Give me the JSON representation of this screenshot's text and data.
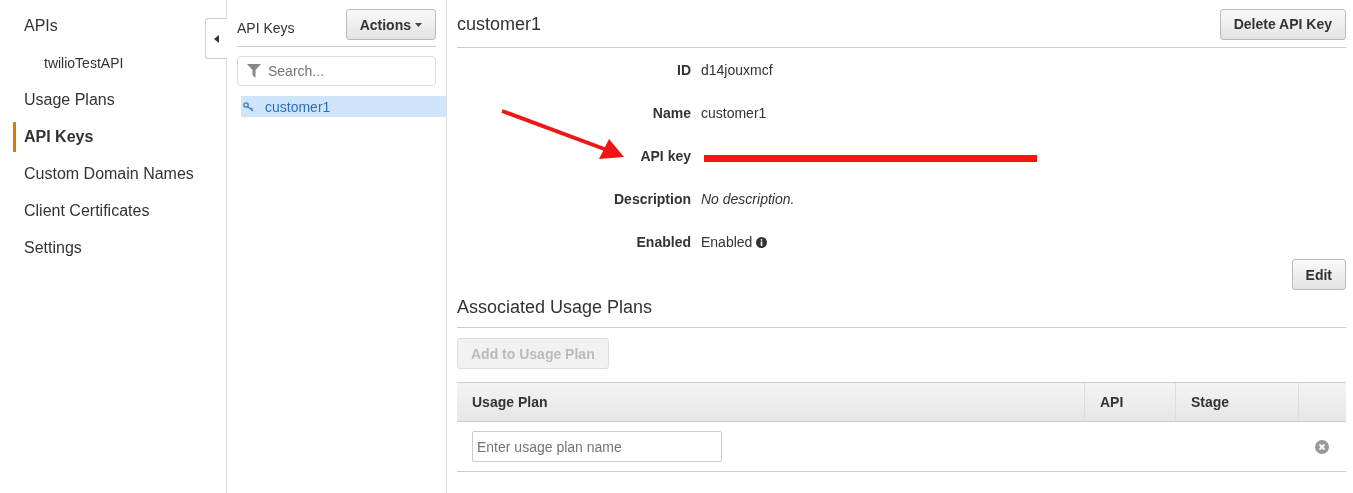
{
  "sidebar": {
    "items": [
      {
        "label": "APIs",
        "selected": false,
        "children": [
          {
            "label": "twilioTestAPI",
            "selected": false
          }
        ]
      },
      {
        "label": "Usage Plans",
        "selected": false
      },
      {
        "label": "API Keys",
        "selected": true
      },
      {
        "label": "Custom Domain Names",
        "selected": false
      },
      {
        "label": "Client Certificates",
        "selected": false
      },
      {
        "label": "Settings",
        "selected": false
      }
    ]
  },
  "keys_panel": {
    "title": "API Keys",
    "actions_button": "Actions",
    "search": {
      "placeholder": "Search..."
    },
    "items": [
      {
        "label": "customer1",
        "selected": true
      }
    ]
  },
  "detail": {
    "title": "customer1",
    "delete_button": "Delete API Key",
    "fields": [
      {
        "kind": "text",
        "label": "ID",
        "value": "d14jouxmcf"
      },
      {
        "kind": "text",
        "label": "Name",
        "value": "customer1"
      },
      {
        "kind": "redacted",
        "label": "API key"
      },
      {
        "kind": "italic",
        "label": "Description",
        "value": "No description."
      },
      {
        "kind": "info",
        "label": "Enabled",
        "value": "Enabled"
      }
    ],
    "edit_button": "Edit",
    "usage_plans": {
      "title": "Associated Usage Plans",
      "add_button": {
        "label": "Add to Usage Plan",
        "disabled": true
      },
      "columns": [
        "Usage Plan",
        "API",
        "Stage"
      ],
      "input": {
        "placeholder": "Enter usage plan name"
      }
    }
  }
}
